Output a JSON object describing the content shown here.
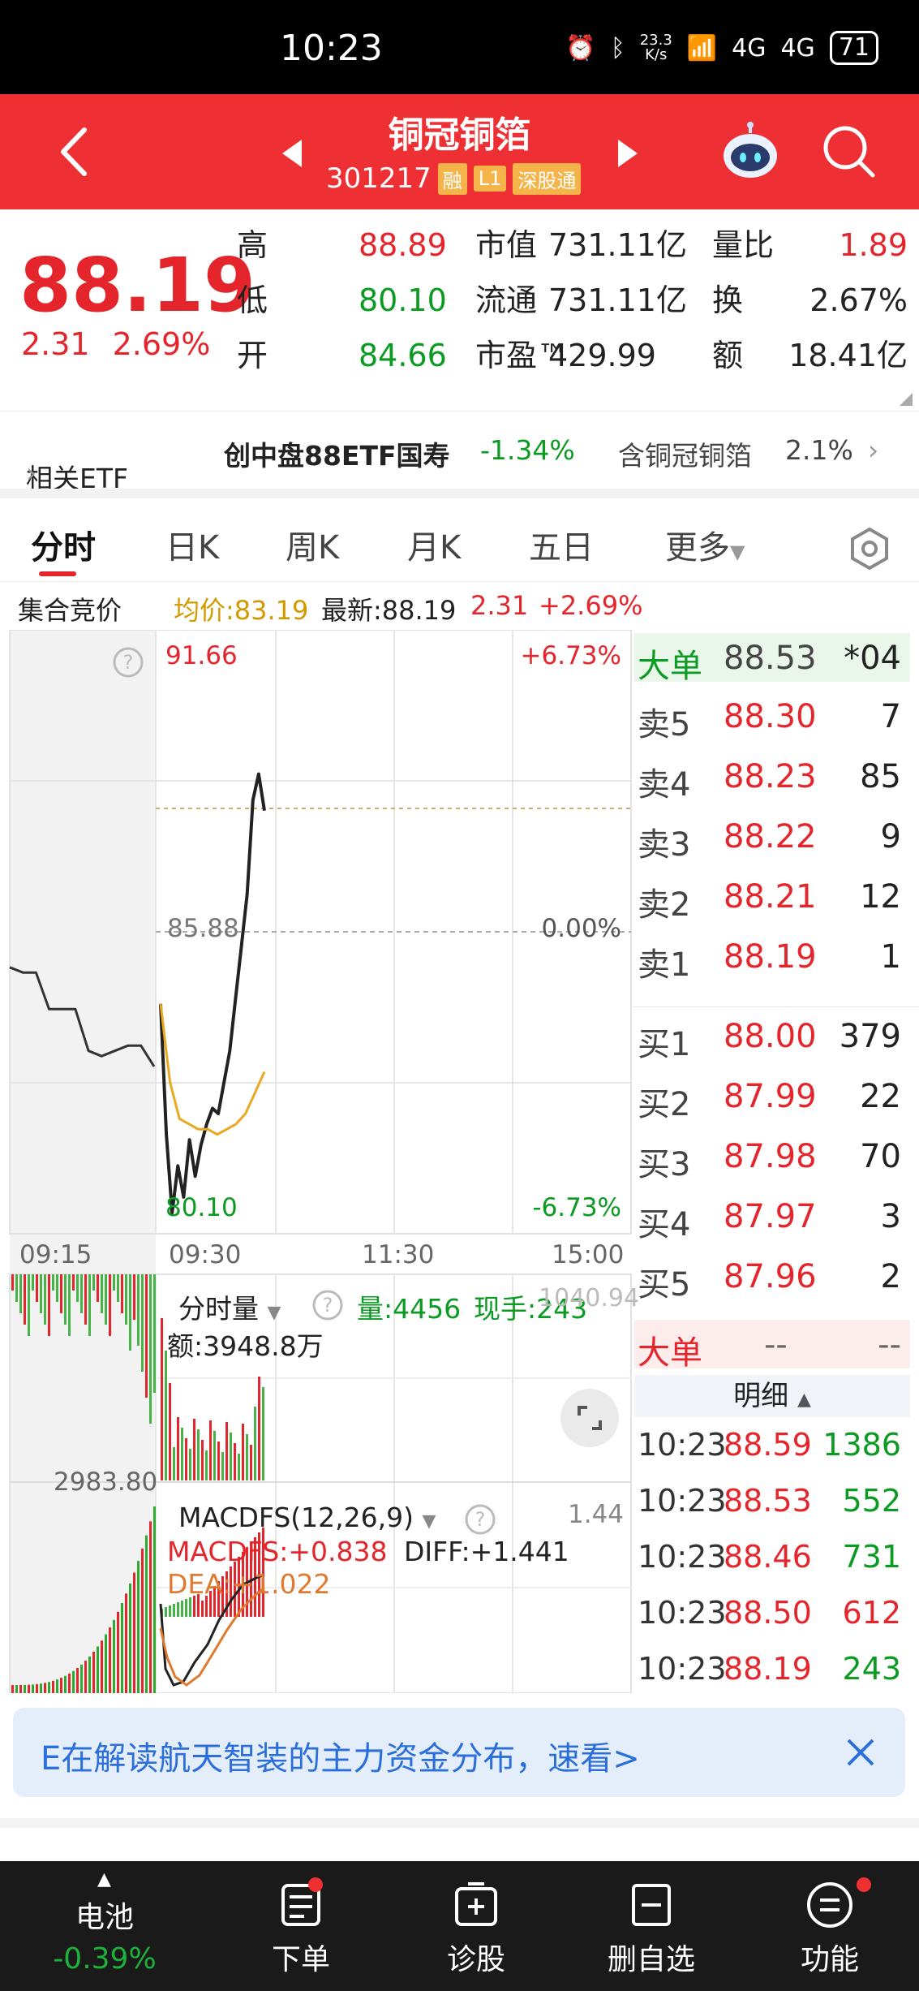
{
  "status_bar": {
    "time": "10:23",
    "net_speed_top": "23.3",
    "net_speed_unit": "K/s",
    "net_1": "4G",
    "net_2": "4G",
    "battery": "71"
  },
  "header": {
    "stock_name": "铜冠铜箔",
    "stock_code": "301217",
    "tags": [
      "融",
      "L1",
      "深股通"
    ],
    "accent_color": "#ee3034"
  },
  "quote": {
    "last_price": "88.19",
    "change": "2.31",
    "change_pct": "2.69%",
    "high_label": "高",
    "high": "88.89",
    "low_label": "低",
    "low": "80.10",
    "open_label": "开",
    "open": "84.66",
    "mktcap_label": "市值",
    "mktcap": "731.11亿",
    "float_label": "流通",
    "float": "731.11亿",
    "pe_label": "市盈™",
    "pe": "429.99",
    "volratio_label": "量比",
    "volratio": "1.89",
    "turnover_label": "换",
    "turnover": "2.67%",
    "amount_label": "额",
    "amount": "18.41亿"
  },
  "etf": {
    "label": "相关ETF",
    "name": "创中盘88ETF国寿",
    "change": "-1.34%",
    "holding_label": "含铜冠铜箔",
    "holding_pct": "2.1%"
  },
  "tabs": [
    "分时",
    "日K",
    "周K",
    "月K",
    "五日",
    "更多"
  ],
  "info_line": {
    "auction_label": "集合竞价",
    "avg_price": "均价:83.19",
    "latest": "最新:88.19",
    "change": "2.31",
    "change_pct": "+2.69%"
  },
  "chart": {
    "price_high": "91.66",
    "price_mid": "85.88",
    "price_low": "80.10",
    "pct_high": "+6.73%",
    "pct_mid": "0.00%",
    "pct_low": "-6.73%",
    "times": [
      "09:15",
      "09:30",
      "11:30",
      "15:00"
    ],
    "volume_panel": {
      "title": "分时量",
      "volume": "量:4456",
      "current_hand": "现手:243",
      "max_vol": "1040.94",
      "amount": "额:3948.8万",
      "auction_max": "2983.80"
    },
    "macd_panel": {
      "title": "MACDFS(12,26,9)",
      "macdfs": "MACDFS:+0.838",
      "diff": "DIFF:+1.441",
      "dea": "DEA:+1.022",
      "scale_top": "1.44"
    }
  },
  "chart_data": {
    "type": "line",
    "title": "",
    "xlabel": "",
    "ylabel": "",
    "ylim": [
      80.1,
      91.66
    ],
    "base_price": 85.88,
    "x_ticks": [
      "09:15",
      "09:30",
      "11:30",
      "15:00"
    ],
    "series": [
      {
        "values": [
          85.2,
          85.1,
          85.1,
          84.4,
          84.4,
          84.4,
          83.6,
          83.5,
          83.6,
          83.7,
          83.7,
          83.3
        ]
      },
      {
        "values": [
          84.5,
          82.0,
          80.5,
          81.4,
          80.8,
          81.9,
          81.2,
          81.8,
          82.2,
          82.5,
          82.4,
          83.0,
          83.6,
          84.6,
          85.6,
          86.6,
          88.4,
          88.9,
          88.2
        ]
      },
      {
        "values": [
          84.5,
          83.0,
          82.3,
          82.2,
          82.1,
          82.1,
          82.0,
          82.1,
          82.2,
          82.4,
          82.8,
          83.2
        ]
      }
    ]
  },
  "orderbook": {
    "big_order_label": "大单",
    "big_order_price": "88.53",
    "big_order_vol": "*04",
    "asks": [
      {
        "label": "卖5",
        "price": "88.30",
        "vol": "7"
      },
      {
        "label": "卖4",
        "price": "88.23",
        "vol": "85"
      },
      {
        "label": "卖3",
        "price": "88.22",
        "vol": "9"
      },
      {
        "label": "卖2",
        "price": "88.21",
        "vol": "12"
      },
      {
        "label": "卖1",
        "price": "88.19",
        "vol": "1"
      }
    ],
    "bids": [
      {
        "label": "买1",
        "price": "88.00",
        "vol": "379"
      },
      {
        "label": "买2",
        "price": "87.99",
        "vol": "22"
      },
      {
        "label": "买3",
        "price": "87.98",
        "vol": "70"
      },
      {
        "label": "买4",
        "price": "87.97",
        "vol": "3"
      },
      {
        "label": "买5",
        "price": "87.96",
        "vol": "2"
      }
    ],
    "big_order2_label": "大单",
    "big_order2_price": "--",
    "big_order2_vol": "--",
    "detail_label": "明细",
    "ticks": [
      {
        "time": "10:23",
        "price": "88.59",
        "vol": "1386"
      },
      {
        "time": "10:23",
        "price": "88.53",
        "vol": "552"
      },
      {
        "time": "10:23",
        "price": "88.46",
        "vol": "731"
      },
      {
        "time": "10:23",
        "price": "88.50",
        "vol": "612"
      },
      {
        "time": "10:23",
        "price": "88.19",
        "vol": "243"
      }
    ]
  },
  "banner": {
    "text": "E在解读航天智装的主力资金分布，速看>"
  },
  "bottom_nav": {
    "index_name": "电池",
    "index_change": "-0.39%",
    "items": [
      "下单",
      "诊股",
      "删自选",
      "功能"
    ]
  }
}
